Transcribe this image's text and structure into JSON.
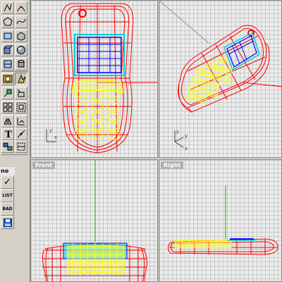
{
  "app": {
    "viewports": {
      "top": {
        "title": ""
      },
      "perspective": {
        "title": ""
      },
      "front": {
        "title": "Front"
      },
      "right": {
        "title": "Right"
      }
    },
    "toolbar": {
      "mode_label": "no",
      "check_symbol": "✓",
      "list_label": "LIST",
      "bad_label": "BAD"
    },
    "colors": {
      "wire_red": "#ff0000",
      "wire_yellow": "#ffff00",
      "wire_blue": "#0000ff",
      "wire_cyan": "#00e0e0",
      "axis_green": "#00c000",
      "grid": "#c8c8c8",
      "viewport_bg": "#ececec"
    },
    "icons": [
      "polyline-icon",
      "arc-icon",
      "polygon-icon",
      "curve-icon",
      "rectangle-icon",
      "extrude-icon",
      "box-icon",
      "sphere-icon",
      "surface-icon",
      "cylinder-icon",
      "boolean-icon",
      "transform-icon",
      "trim-icon",
      "split-icon",
      "array-icon",
      "group-icon",
      "mirror-icon",
      "dimension-icon",
      "text-icon",
      "analyze-icon",
      "render-icon",
      "layer-icon"
    ]
  }
}
